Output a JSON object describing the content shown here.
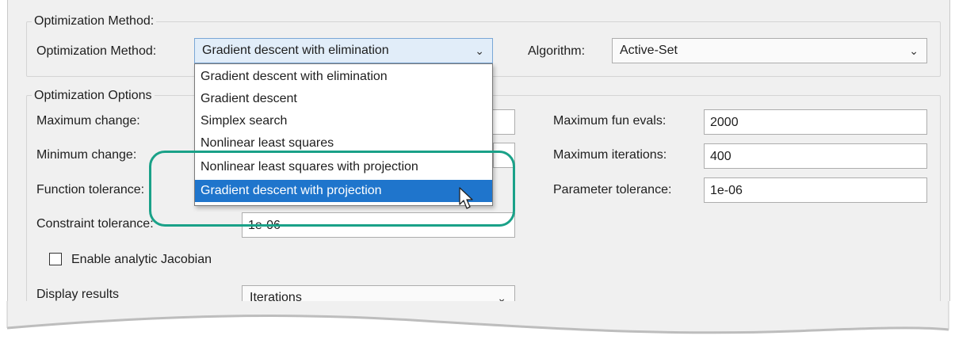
{
  "method_group": {
    "legend": "Optimization Method:",
    "method_label": "Optimization Method:",
    "method_value": "Gradient descent with elimination",
    "algorithm_label": "Algorithm:",
    "algorithm_value": "Active-Set"
  },
  "dropdown": {
    "items": [
      "Gradient descent with elimination",
      "Gradient descent",
      "Simplex search",
      "Nonlinear least squares",
      "Nonlinear least squares with projection",
      "Gradient descent with projection"
    ],
    "highlighted_item": "Gradient descent with projection"
  },
  "options_group": {
    "legend": "Optimization Options",
    "max_change_label": "Maximum change:",
    "min_change_label": "Minimum change:",
    "function_tol_label": "Function tolerance:",
    "constraint_tol_label": "Constraint tolerance:",
    "constraint_tol_value": "1e-06",
    "max_fun_evals_label": "Maximum fun evals:",
    "max_fun_evals_value": "2000",
    "max_iterations_label": "Maximum iterations:",
    "max_iterations_value": "400",
    "parameter_tol_label": "Parameter tolerance:",
    "parameter_tol_value": "1e-06",
    "jacobian_label": "Enable analytic Jacobian",
    "jacobian_checked": false,
    "display_results_label": "Display results",
    "display_results_value": "Iterations"
  },
  "colors": {
    "selection": "#1f75cc",
    "callout": "#1aa188",
    "panel_bg": "#f0f0f0"
  }
}
